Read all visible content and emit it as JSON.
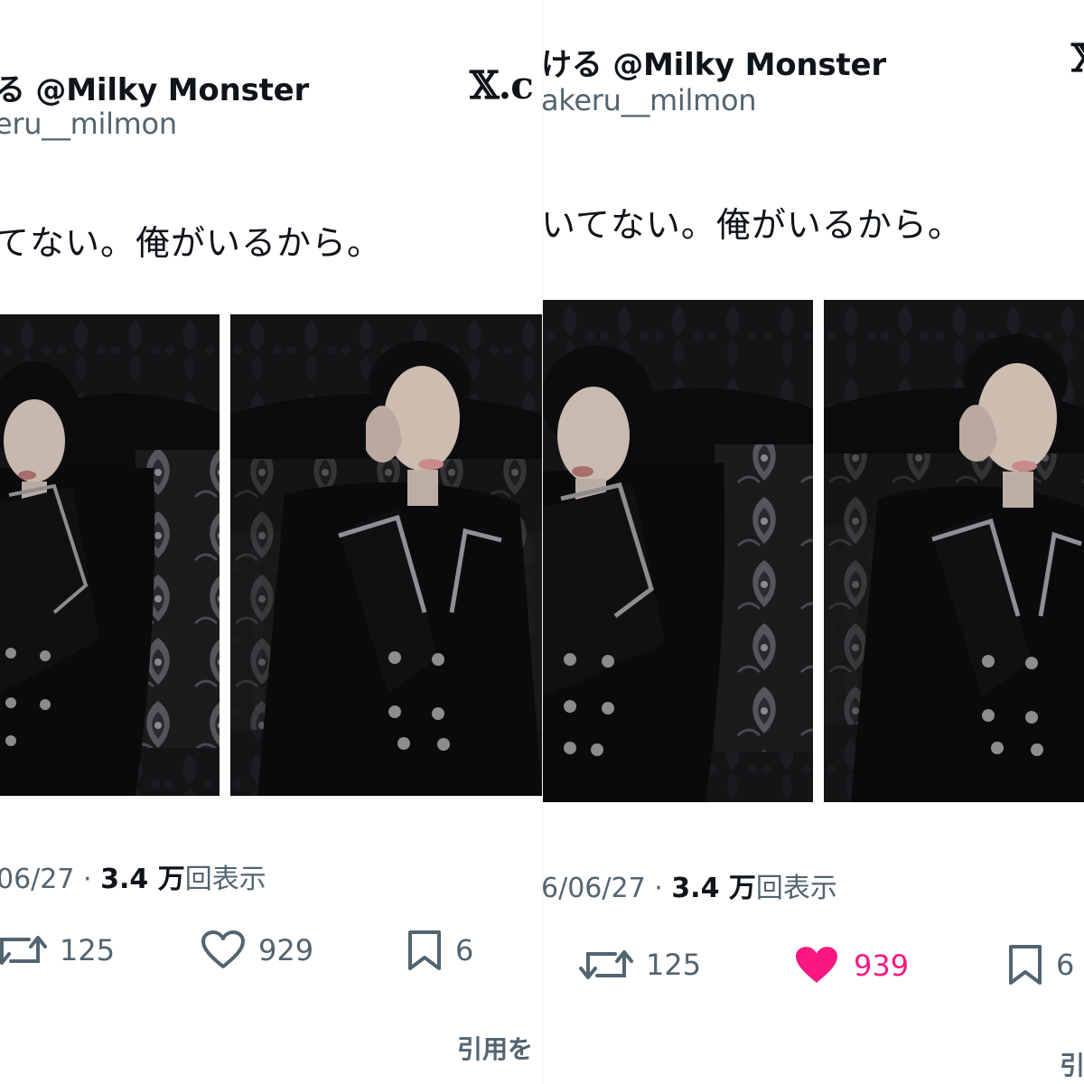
{
  "left_panel": {
    "author": {
      "display_name": "る @Milky Monster",
      "handle": "eru__milmon"
    },
    "tweet_text": "てない。俺がいるから。",
    "x_logo_text": "𝕏.c",
    "timestamp": "06/27",
    "separator": "·",
    "views_count": "3.4 万",
    "views_label": "回表示",
    "retweets": "125",
    "likes": "929",
    "bookmarks": "6",
    "quote_label": "引用を"
  },
  "right_panel": {
    "author": {
      "display_name": "ける @Milky Monster",
      "handle": "akeru__milmon"
    },
    "tweet_text": "いてない。俺がいるから。",
    "x_logo_text": "𝕏",
    "timestamp": "6/06/27",
    "separator": "·",
    "views_count": "3.4 万",
    "views_label": "回表示",
    "retweets": "125",
    "likes": "939",
    "bookmarks": "6",
    "quote_label": "引"
  },
  "icons": {
    "retweet": "retweet-icon",
    "like": "heart-icon",
    "bookmark": "bookmark-icon"
  },
  "colors": {
    "text_primary": "#0f1419",
    "text_secondary": "#536471",
    "like_active": "#f91880",
    "photo_background": "#101012"
  }
}
